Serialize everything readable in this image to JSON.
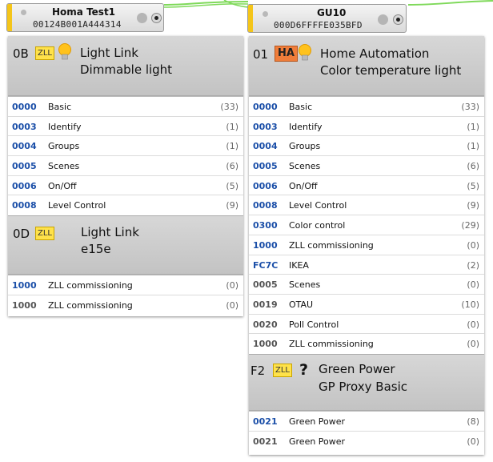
{
  "nodes": [
    {
      "name": "Homa Test1",
      "address": "00124B001A444314",
      "endpoints": [
        {
          "id": "0B",
          "profile": "ZLL",
          "icon": "lightbulb-icon",
          "title_line1": "Light Link",
          "title_line2": "Dimmable light",
          "clusters": [
            {
              "id": "0000",
              "name": "Basic",
              "count": "(33)",
              "server": true
            },
            {
              "id": "0003",
              "name": "Identify",
              "count": "(1)",
              "server": true
            },
            {
              "id": "0004",
              "name": "Groups",
              "count": "(1)",
              "server": true
            },
            {
              "id": "0005",
              "name": "Scenes",
              "count": "(6)",
              "server": true
            },
            {
              "id": "0006",
              "name": "On/Off",
              "count": "(5)",
              "server": true
            },
            {
              "id": "0008",
              "name": "Level Control",
              "count": "(9)",
              "server": true
            }
          ]
        },
        {
          "id": "0D",
          "profile": "ZLL",
          "icon": "",
          "title_line1": "Light Link",
          "title_line2": "e15e",
          "clusters": [
            {
              "id": "1000",
              "name": "ZLL commissioning",
              "count": "(0)",
              "server": true
            },
            {
              "id": "1000",
              "name": "ZLL commissioning",
              "count": "(0)",
              "server": false
            }
          ]
        }
      ]
    },
    {
      "name": "GU10",
      "address": "000D6FFFFE035BFD",
      "endpoints": [
        {
          "id": "01",
          "profile": "HA",
          "icon": "lightbulb-icon",
          "title_line1": "Home Automation",
          "title_line2": "Color temperature light",
          "clusters": [
            {
              "id": "0000",
              "name": "Basic",
              "count": "(33)",
              "server": true
            },
            {
              "id": "0003",
              "name": "Identify",
              "count": "(1)",
              "server": true
            },
            {
              "id": "0004",
              "name": "Groups",
              "count": "(1)",
              "server": true
            },
            {
              "id": "0005",
              "name": "Scenes",
              "count": "(6)",
              "server": true
            },
            {
              "id": "0006",
              "name": "On/Off",
              "count": "(5)",
              "server": true
            },
            {
              "id": "0008",
              "name": "Level Control",
              "count": "(9)",
              "server": true
            },
            {
              "id": "0300",
              "name": "Color control",
              "count": "(29)",
              "server": true
            },
            {
              "id": "1000",
              "name": "ZLL commissioning",
              "count": "(0)",
              "server": true
            },
            {
              "id": "FC7C",
              "name": "IKEA",
              "count": "(2)",
              "server": true
            },
            {
              "id": "0005",
              "name": "Scenes",
              "count": "(0)",
              "server": false
            },
            {
              "id": "0019",
              "name": "OTAU",
              "count": "(10)",
              "server": false
            },
            {
              "id": "0020",
              "name": "Poll Control",
              "count": "(0)",
              "server": false
            },
            {
              "id": "1000",
              "name": "ZLL commissioning",
              "count": "(0)",
              "server": false
            }
          ]
        },
        {
          "id": "F2",
          "profile": "ZLL",
          "icon": "question-mark-icon",
          "title_line1": "Green Power",
          "title_line2": "GP Proxy Basic",
          "clusters": [
            {
              "id": "0021",
              "name": "Green Power",
              "count": "(8)",
              "server": true
            },
            {
              "id": "0021",
              "name": "Green Power",
              "count": "(0)",
              "server": false
            }
          ]
        }
      ]
    }
  ],
  "colors": {
    "server_cluster_id": "#1b4fa8",
    "client_cluster_id": "#555555",
    "zll_badge": "#ffe24a",
    "ha_badge": "#f07d3a",
    "link_wire": "#7fd95a"
  }
}
